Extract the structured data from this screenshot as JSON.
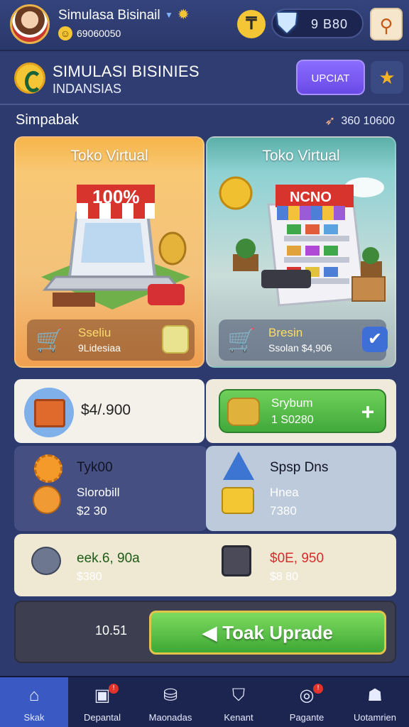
{
  "user": {
    "name": "Simulasa Bisinail",
    "coins": "69060050"
  },
  "wallet": {
    "gems": "9 B80"
  },
  "header": {
    "title": "SIMULASI BISINIES",
    "subtitle": "INDANSIAS",
    "upgrade_label": "UPCIAT"
  },
  "section": {
    "label": "Simpabak",
    "stat": "360 10600"
  },
  "shops": [
    {
      "title": "Toko Virtual",
      "sign": "100%",
      "name": "Sseliu",
      "sub": "9Lidesiaa",
      "color": "#f6b54a"
    },
    {
      "title": "Toko Virtual",
      "sign": "NCNO",
      "name": "Bresin",
      "sub": "Ssolan $4,906",
      "color": "#5bb0a8"
    }
  ],
  "stats": {
    "money": "$4/.900",
    "premium": {
      "name": "Srybum",
      "value": "1 S0280"
    },
    "left": {
      "name": "Tyk00",
      "sub": "Slorobill",
      "value": "$2 30"
    },
    "right": {
      "name": "Spsp Dns",
      "sub": "Hnea",
      "value": "7380"
    },
    "row3_left": {
      "value": "eek.6, 90a",
      "sub": "$380"
    },
    "row3_right": {
      "value": "$0E, 950",
      "sub": "$8 80"
    }
  },
  "action": {
    "timer": "10.51",
    "label": "Toak Uprade"
  },
  "nav": [
    {
      "label": "Skak",
      "icon": "home-icon",
      "active": true
    },
    {
      "label": "Depantal",
      "icon": "monitor-icon",
      "badge": "!"
    },
    {
      "label": "Maonadas",
      "icon": "bag-icon"
    },
    {
      "label": "Kenant",
      "icon": "shield-icon"
    },
    {
      "label": "Pagante",
      "icon": "target-icon",
      "badge": "!"
    },
    {
      "label": "Uotamrien",
      "icon": "user-icon"
    }
  ],
  "colors": {
    "background": "#2c3a6e",
    "accent_purple": "#6a4ae6",
    "accent_green": "#41a83b",
    "nav_active": "#3a59c2"
  }
}
